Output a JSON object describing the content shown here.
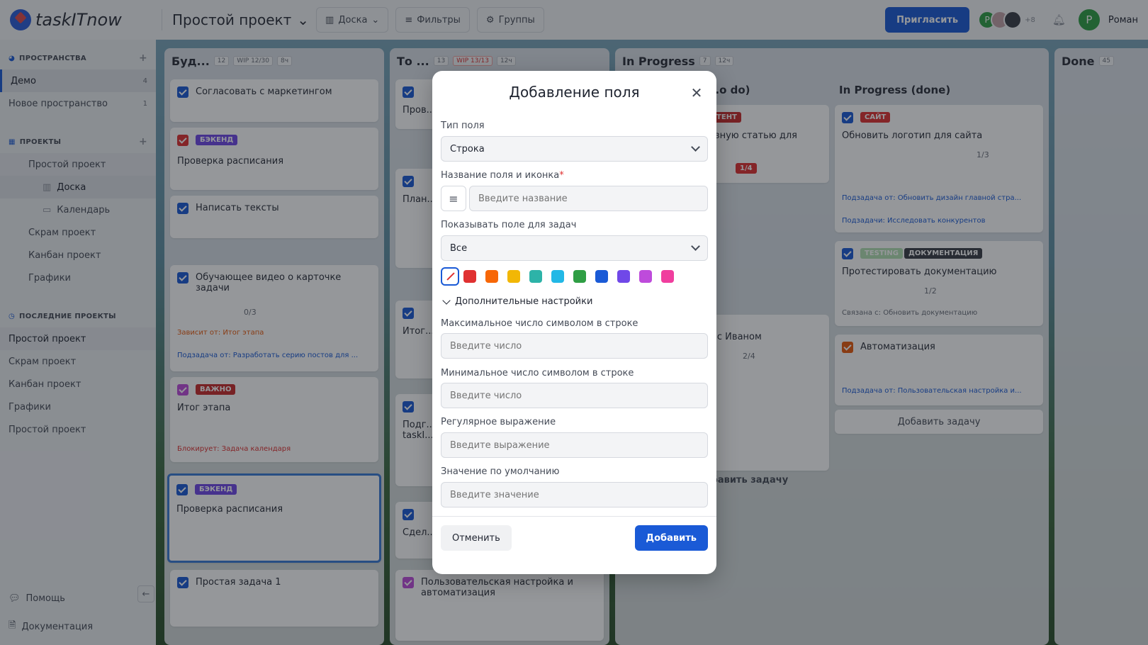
{
  "app": {
    "name": "taskITnow"
  },
  "header": {
    "project_title": "Простой проект",
    "view_label": "Доска",
    "filters_label": "Фильтры",
    "groups_label": "Группы",
    "invite_label": "Пригласить",
    "avatar_letter": "Р",
    "extra_members": "+8",
    "user_name": "Роман"
  },
  "sidebar": {
    "spaces_title": "ПРОСТРАНСТВА",
    "spaces": [
      {
        "label": "Демо",
        "count": "4"
      },
      {
        "label": "Новое пространство",
        "count": "1"
      }
    ],
    "projects_title": "ПРОЕКТЫ",
    "projects": [
      {
        "label": "Простой проект"
      },
      {
        "label": "Доска"
      },
      {
        "label": "Календарь"
      },
      {
        "label": "Скрам проект"
      },
      {
        "label": "Канбан проект"
      },
      {
        "label": "Графики"
      }
    ],
    "recent_title": "ПОСЛЕДНИЕ ПРОЕКТЫ",
    "recent": [
      {
        "label": "Простой проект"
      },
      {
        "label": "Скрам проект"
      },
      {
        "label": "Канбан проект"
      },
      {
        "label": "Графики"
      },
      {
        "label": "Простой проект"
      }
    ],
    "help_label": "Помощь",
    "docs_label": "Документация"
  },
  "board": {
    "columns": [
      {
        "title": "Буд...",
        "count": "12",
        "wip": "WIP 12/30",
        "time": "8ч"
      },
      {
        "title": "То ...",
        "count": "13",
        "wip": "WIP 13/13",
        "time": "12ч"
      },
      {
        "title": "In Progress",
        "count": "7",
        "time": "12ч",
        "sub_left": "...o do)",
        "sub_right": "In Progress (done)"
      },
      {
        "title": "Done",
        "count": "45"
      }
    ],
    "cards_col1": [
      {
        "title": "Согласовать с маркетингом"
      },
      {
        "title": "Проверка расписания",
        "tag": "БЭКЕНД"
      },
      {
        "title": "Написать тексты"
      },
      {
        "title": "Обучающее видео о карточке задачи",
        "meta": "0/3",
        "note1": "Зависит от: Итог этапа",
        "note2": "Подзадача от: Разработать серию постов для ..."
      },
      {
        "title": "Итог этапа",
        "tag": "ВАЖНО",
        "note1": "Блокирует: Задача календаря"
      },
      {
        "title": "Проверка расписания",
        "tag": "БЭКЕНД"
      },
      {
        "title": "Простая задача 1"
      }
    ],
    "cards_col2": [
      {
        "title": "Пров..."
      },
      {
        "title": "План..."
      },
      {
        "title": "Итог..."
      },
      {
        "title": "Подг... taskI..."
      },
      {
        "title": "Сдел..."
      },
      {
        "title": "Пользовательская настройка и автоматизация"
      }
    ],
    "cards_col3": [
      {
        "title": "...лезную статью для",
        "tag": "КОНТЕНТ",
        "meta": "1/4"
      },
      {
        "title": "...чу с Иваном",
        "meta": "2/4"
      }
    ],
    "cards_col4": [
      {
        "title": "Обновить логотип для сайта",
        "tag": "САЙТ",
        "meta": "1/3",
        "note1": "Подзадача от: Обновить дизайн главной стра...",
        "note2": "Подзадачи: Исследовать конкурентов"
      },
      {
        "title": "Протестировать документацию",
        "tag": "TESTING",
        "tag2": "ДОКУМЕНТАЦИЯ",
        "meta": "1/2",
        "note1": "Связана с: Обновить документацию"
      },
      {
        "title": "Автоматизация",
        "note1": "Подзадача от: Пользовательская настройка и..."
      }
    ],
    "add_task_label": "Добавить задачу",
    "add_task_label_partial": "...обавить задачу"
  },
  "modal": {
    "title": "Добавление поля",
    "field_type_label": "Тип поля",
    "field_type_value": "Строка",
    "name_label": "Название поля и иконка",
    "required_mark": "*",
    "name_placeholder": "Введите название",
    "show_label": "Показывать поле для задач",
    "show_value": "Все",
    "advanced_label": "Дополнительные настройки",
    "max_label": "Максимальное число символом в строке",
    "max_placeholder": "Введите число",
    "min_label": "Минимальное число символом в строке",
    "min_placeholder": "Введите число",
    "regex_label": "Регулярное выражение",
    "regex_placeholder": "Введите выражение",
    "default_label": "Значение по умолчанию",
    "default_placeholder": "Введите значение",
    "cancel_label": "Отменить",
    "add_label": "Добавить",
    "colors": [
      "#e03131",
      "#f76707",
      "#f2b705",
      "#2db3a8",
      "#22b8e6",
      "#2f9e44",
      "#1a5ad6",
      "#7048e8",
      "#be4bdb",
      "#f03e9e"
    ]
  }
}
